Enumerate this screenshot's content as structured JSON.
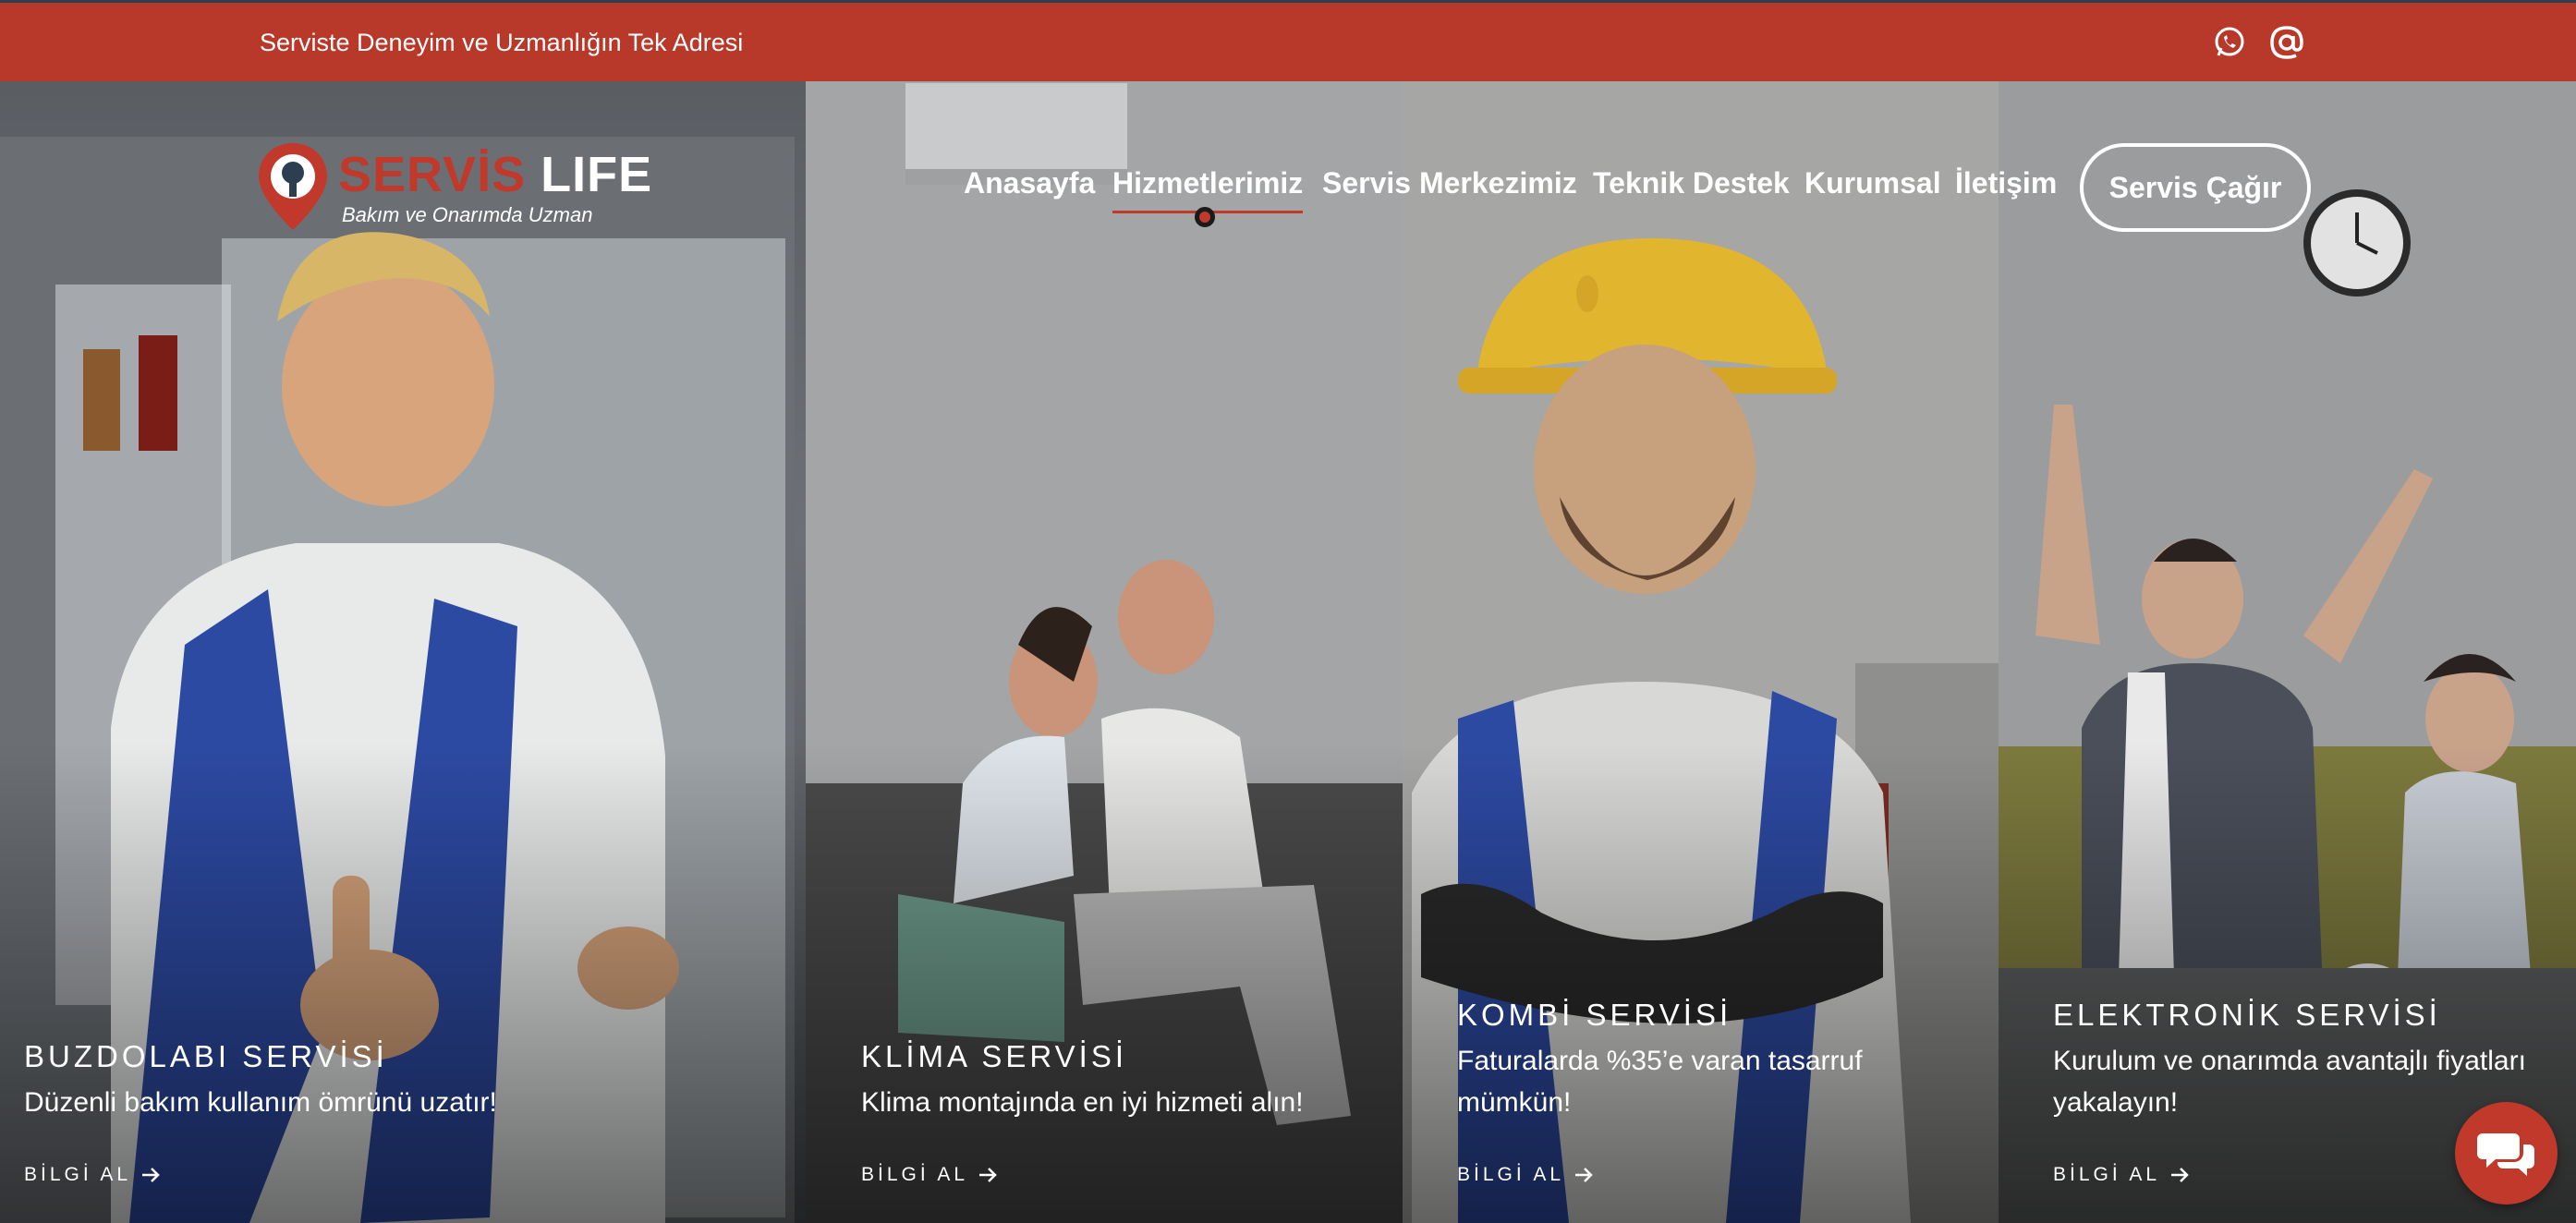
{
  "topbar": {
    "tagline": "Serviste Deneyim ve Uzmanlığın Tek Adresi",
    "icons": [
      "whatsapp-icon",
      "at-sign-icon"
    ],
    "background": "#b8392a"
  },
  "logo": {
    "brand_part1": "SERVİS",
    "brand_part2": "LIFE",
    "slogan": "Bakım ve Onarımda Uzman"
  },
  "nav": {
    "items": [
      "Anasayfa",
      "Hizmetlerimiz",
      "Servis Merkezimiz",
      "Teknik Destek",
      "Kurumsal",
      "İletişim"
    ],
    "active": "Hizmetlerimiz",
    "cta": "Servis Çağır"
  },
  "cards": [
    {
      "title": "BUZDOLABI SERVİSİ",
      "text": "Düzenli bakım kullanım ömrünü uzatır!",
      "link": "BİLGİ AL"
    },
    {
      "title": "KLİMA SERVİSİ",
      "text": "Klima montajında en iyi hizmeti alın!",
      "link": "BİLGİ AL"
    },
    {
      "title": "KOMBİ SERVİSİ",
      "text_line1": "Faturalarda %35’e varan tasarruf",
      "text_line2": "mümkün!",
      "link": "BİLGİ AL"
    },
    {
      "title": "ELEKTRONİK SERVİSİ",
      "text_line1": "Kurulum ve onarımda avantajlı fiyatları",
      "text_line2": "yakalayın!",
      "link": "BİLGİ AL"
    }
  ],
  "chat": {
    "icon": "chat-bubbles-icon"
  },
  "colors": {
    "accent": "#c0392b",
    "dark": "#2c3e50"
  }
}
